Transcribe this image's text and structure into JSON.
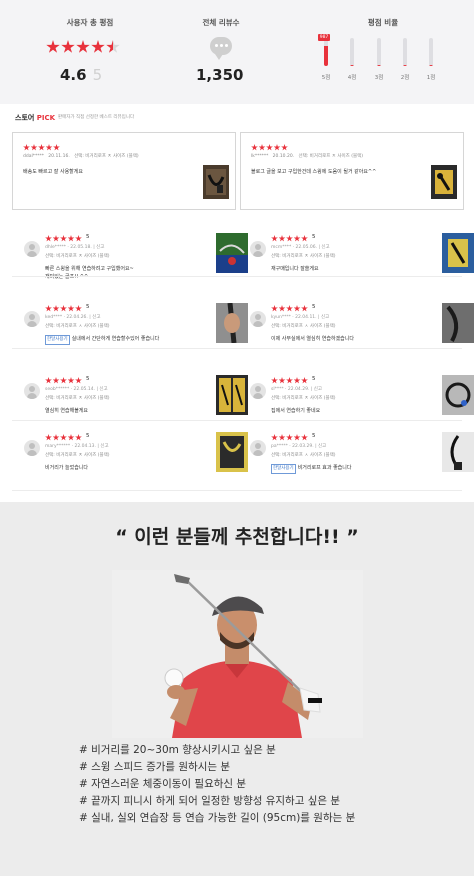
{
  "summary": {
    "satisfaction_label": "사용자 총 평점",
    "rating_avg": "4.6",
    "rating_max": "5",
    "total_label": "전체 리뷰수",
    "total_count": "1,350",
    "ratio_label": "평점 비율",
    "bars": [
      {
        "label": "5점",
        "ratio": 0.72,
        "badge": "987"
      },
      {
        "label": "4점",
        "ratio": 0.05
      },
      {
        "label": "3점",
        "ratio": 0.03
      },
      {
        "label": "2점",
        "ratio": 0.02
      },
      {
        "label": "1점",
        "ratio": 0.02
      }
    ]
  },
  "store_pick": {
    "title_store": "스토어",
    "title_pick": "PICK",
    "subtitle": "판매자가 직접 선정한 베스트 리뷰입니다",
    "cards": [
      {
        "user": "ddal*****",
        "date": "20.11.16.",
        "option": "선택: 비거리로프 ㅈ 사이즈 (블랙)",
        "text": "배송도 빠르고 잘 사용할게요"
      },
      {
        "user": "lk******",
        "date": "20.10.20.",
        "option": "선택: 비거리로프 ㅈ 사이즈 (블랙)",
        "text": "블로그 글을 보고 구입한건데 스윙에 도움이 될거 같아요^^"
      }
    ]
  },
  "reviews": [
    {
      "score": "5",
      "user": "dhle*****",
      "date": "22.05.18.",
      "report": "신고",
      "option": "선택: 비거리로프 ㅈ 사이즈 (블랙)",
      "badge": "",
      "text1": "빠른 스윙을 위해 연습하려고 구입했어요~",
      "text2": "재미있는 골프!! ^^"
    },
    {
      "score": "5",
      "user": "mcm****",
      "date": "22.05.06.",
      "report": "신고",
      "option": "선택: 비거리로프 ㅈ 사이즈 (블랙)",
      "badge": "",
      "text1": "재구매입니다 잘쓸게요",
      "text2": ""
    },
    {
      "score": "5",
      "user": "ked****",
      "date": "22.04.26.",
      "report": "신고",
      "option": "선택: 비거리로프 ㅅ 사이즈 (블랙)",
      "badge": "한달사용기",
      "text1": "실내에서 간단하게 연습할수있어 좋습니다",
      "text2": ""
    },
    {
      "score": "5",
      "user": "kyun****",
      "date": "22.04.11.",
      "report": "신고",
      "option": "선택: 비거리로프 ㅅ 사이즈 (블랙)",
      "badge": "",
      "text1": "이제 사무실에서 열심히 연습하겠습니다",
      "text2": ""
    },
    {
      "score": "5",
      "user": "seob******",
      "date": "22.05.14.",
      "report": "신고",
      "option": "선택: 비거리로프 ㅈ 사이즈 (블랙)",
      "badge": "",
      "text1": "열심히 연습해볼게요",
      "text2": ""
    },
    {
      "score": "5",
      "user": "sl****",
      "date": "22.04.29.",
      "report": "신고",
      "option": "선택: 비거리로프 ㅈ 사이즈 (블랙)",
      "badge": "",
      "text1": "집에서 연습하기 좋네요",
      "text2": ""
    },
    {
      "score": "5",
      "user": "mary******",
      "date": "22.04.13.",
      "report": "신고",
      "option": "선택: 비거리로프 ㅈ 사이즈 (블랙)",
      "badge": "",
      "text1": "비거리가 늘었습니다",
      "text2": ""
    },
    {
      "score": "5",
      "user": "pa*****",
      "date": "22.03.29.",
      "report": "신고",
      "option": "선택: 비거리로프 ㅅ 사이즈 (블랙)",
      "badge": "한달사용기",
      "text1": "비거리로프 효과 좋습니다",
      "text2": ""
    }
  ],
  "recommend": {
    "title": "“ 이런 분들께 추천합니다!! ”",
    "lines": [
      "# 비거리를 20~30m 향상시키시고 싶은 분",
      "# 스윙 스피드 증가를 원하시는 분",
      "# 자연스러운 체중이동이 필요하신 분",
      "# 끝까지 피니시 하게 되어 일정한 방향성 유지하고 싶은 분",
      "# 실내, 실외 연습장 등 연습 가능한 길이 (95cm)를 원하는 분"
    ]
  },
  "colors": {
    "accent": "#e8323c",
    "bg_gray": "#f4f4f6",
    "rec_bg": "#ececec"
  }
}
